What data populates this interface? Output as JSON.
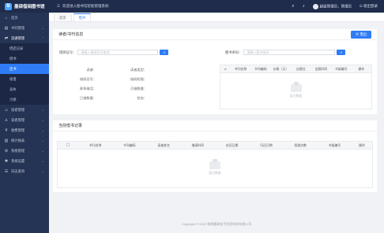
{
  "topbar": {
    "logo_text": "墨砚借阅图书馆",
    "system_title": "欢迎进入图书馆智能管理系统",
    "user_name": "超级管理员，管理员",
    "logout": "退出登录"
  },
  "sidebar": {
    "items": [
      {
        "label": "首页",
        "icon": "home-icon"
      },
      {
        "label": "书刊管理",
        "icon": "book-icon"
      },
      {
        "label": "流通管理",
        "icon": "circulation-icon"
      }
    ],
    "sub_items": [
      {
        "label": "借还记录"
      },
      {
        "label": "借书"
      },
      {
        "label": "还书"
      },
      {
        "label": "续借"
      },
      {
        "label": "丢失"
      },
      {
        "label": "污损"
      }
    ],
    "more_items": [
      {
        "label": "读者管理",
        "icon": "reader-icon"
      },
      {
        "label": "读者管理",
        "icon": "user-icon"
      },
      {
        "label": "收费管理",
        "icon": "fee-icon"
      },
      {
        "label": "统计报表",
        "icon": "chart-icon"
      },
      {
        "label": "系统管理",
        "icon": "gear-icon"
      },
      {
        "label": "系统设置",
        "icon": "settings-icon"
      },
      {
        "label": "日志查询",
        "icon": "log-icon"
      }
    ]
  },
  "tabs": [
    {
      "label": "首页"
    },
    {
      "label": "借书"
    }
  ],
  "borrow_panel": {
    "title": "读者/书刊信息",
    "borrow_button": "借出",
    "reader_field_label": "借阅证号：",
    "reader_placeholder": "请输入借阅证号查询",
    "book_field_label": "图书条码：",
    "book_placeholder": "请输入图书条码",
    "reader_info_left": [
      "读者：",
      "借阅证号：",
      "联系电话：",
      "已借数量："
    ],
    "reader_info_right": [
      "读者类型：",
      "借阅权限：",
      "可借数量：",
      "状态："
    ],
    "book_table_headers": [
      "#",
      "书刊名称",
      "书刊编码",
      "价格（元）",
      "出版社",
      "出版时间",
      "书架编号",
      "操作"
    ],
    "empty_text": "暂无数据"
  },
  "record_panel": {
    "title": "当前借书记录",
    "table_headers": [
      "",
      "书刊名称",
      "书刊编码",
      "读者姓名",
      "借阅时间",
      "应还日期",
      "归还日期",
      "续借次数",
      "书架编号",
      "操作"
    ],
    "empty_text": "暂无数据"
  },
  "footer": {
    "text": "Copyright © 2022 湖南墨砚电子信息科技有限公司"
  }
}
